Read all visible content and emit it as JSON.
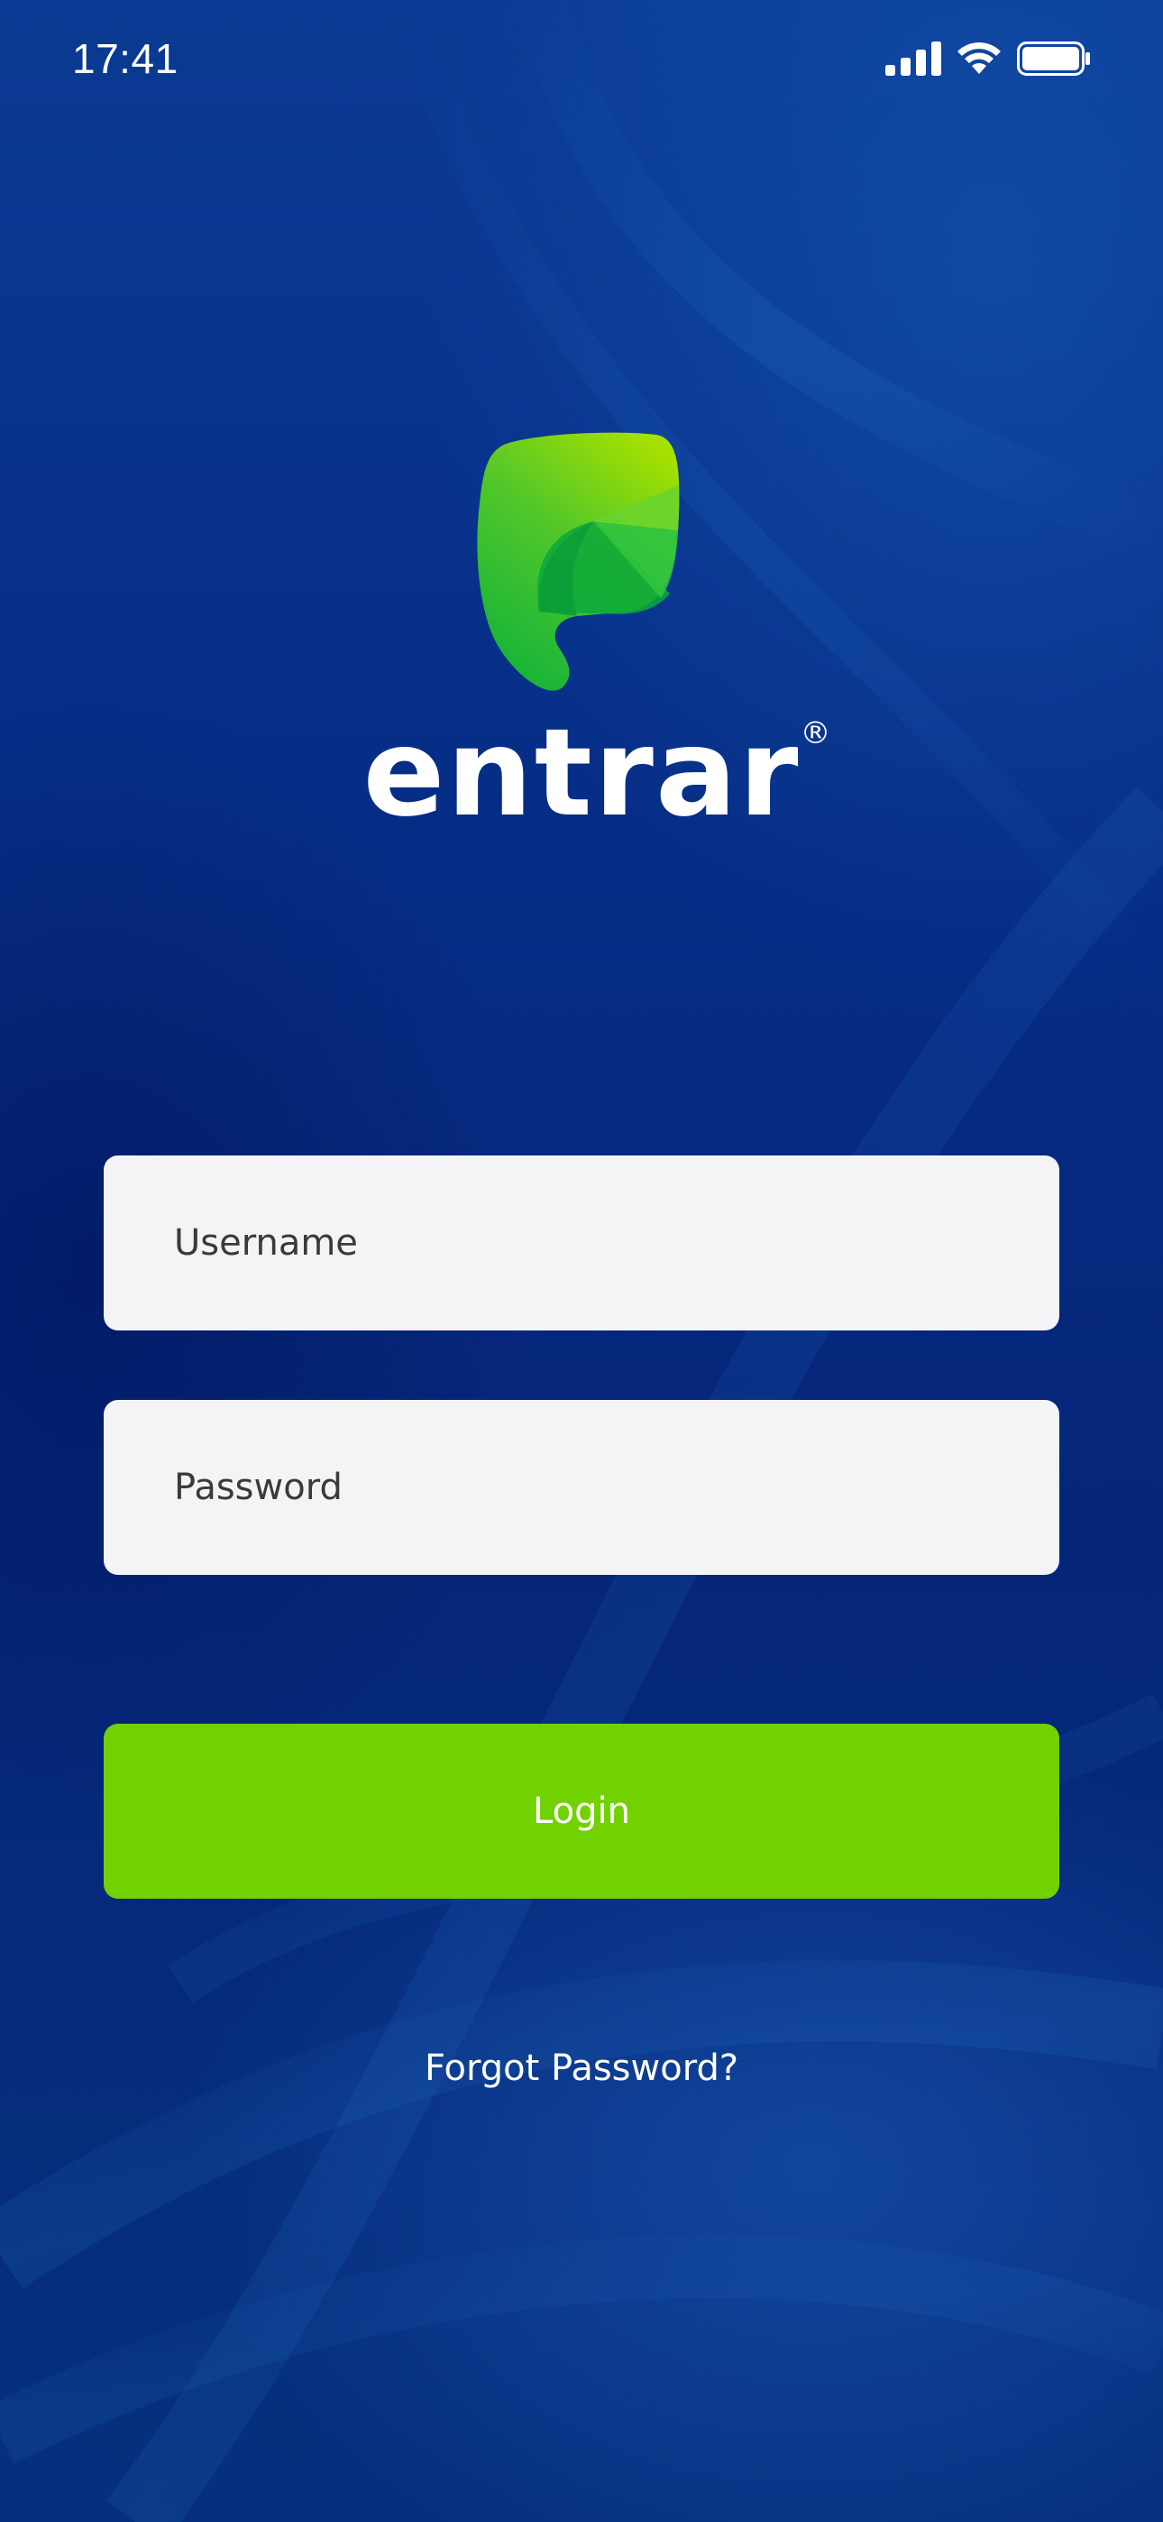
{
  "status_bar": {
    "time": "17:41",
    "icons": [
      "cellular-signal-icon",
      "wifi-icon",
      "battery-icon"
    ]
  },
  "logo": {
    "icon": "leaf-logo-icon",
    "brand_name": "entrar",
    "registered_mark": "®"
  },
  "form": {
    "username": {
      "value": "",
      "placeholder": "Username"
    },
    "password": {
      "value": "",
      "placeholder": "Password"
    },
    "login_label": "Login",
    "forgot_label": "Forgot Password?"
  },
  "colors": {
    "background": "#062c85",
    "field_background": "#f4f3f6",
    "button": "#72d100",
    "logo_light": "#a8e000",
    "logo_dark": "#0fa83a",
    "text_light": "#ffffff"
  }
}
